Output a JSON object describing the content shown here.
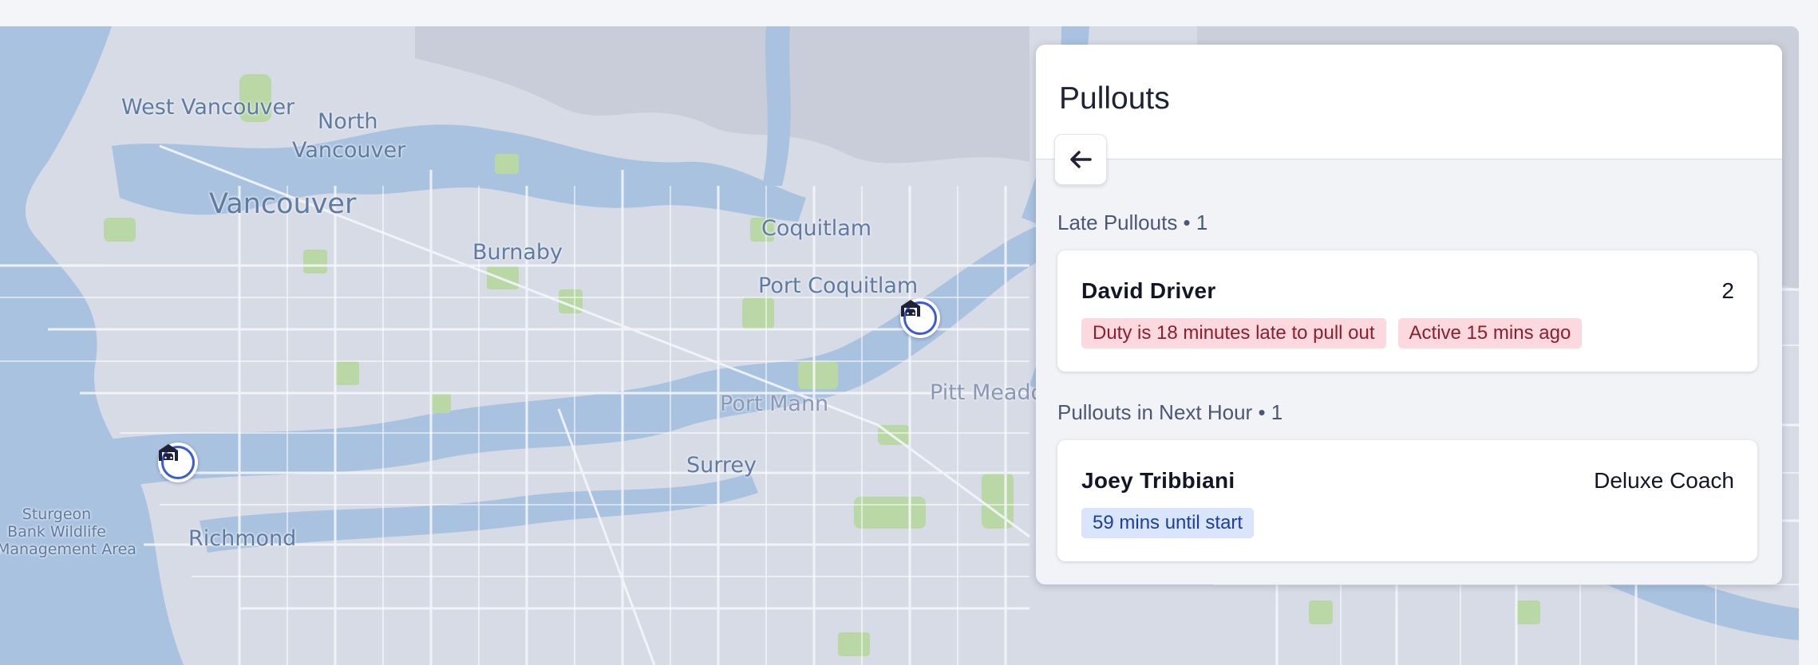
{
  "map": {
    "labels": {
      "west_vancouver": "West Vancouver",
      "north_vancouver_1": "North",
      "north_vancouver_2": "Vancouver",
      "vancouver": "Vancouver",
      "burnaby": "Burnaby",
      "coquitlam": "Coquitlam",
      "port_coquitlam": "Port Coquitlam",
      "pitt_meadows": "Pitt Meadow",
      "port_mann": "Port Mann",
      "surrey": "Surrey",
      "richmond": "Richmond",
      "sturgeon_1": "Sturgeon",
      "sturgeon_2": "Bank Wildlife",
      "sturgeon_3": "Management Area"
    },
    "markers": [
      {
        "icon": "garage-car-icon"
      },
      {
        "icon": "garage-car-icon"
      }
    ]
  },
  "panel": {
    "title": "Pullouts",
    "back_icon": "arrow-left-icon",
    "sections": [
      {
        "title": "Late Pullouts • 1",
        "cards": [
          {
            "name": "David Driver",
            "right": "2",
            "badges": [
              "Duty is 18 minutes late to pull out",
              "Active 15 mins ago"
            ]
          }
        ]
      },
      {
        "title": "Pullouts in Next Hour • 1",
        "cards": [
          {
            "name": "Joey Tribbiani",
            "right": "Deluxe Coach",
            "badges": [
              "59 mins until start"
            ]
          }
        ]
      }
    ]
  },
  "colors": {
    "map_land": "#d7dbe6",
    "map_water": "#a9c2e0",
    "map_park": "#b9d8a6",
    "marker_ring": "#3b5bdb",
    "late_badge_bg": "#fbd9de",
    "late_badge_text": "#8b1f2e",
    "info_badge_bg": "#d8e5fb",
    "info_badge_text": "#1f3e9b"
  }
}
